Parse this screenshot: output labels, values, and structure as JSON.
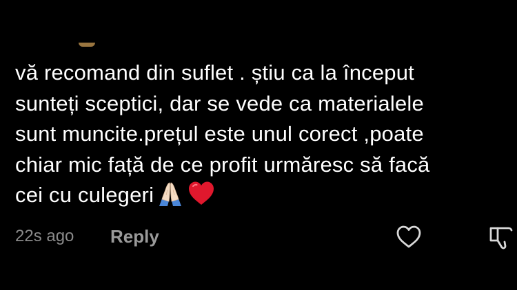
{
  "comment": {
    "lines": [
      "vă recomand din suflet . știu ca la început",
      "sunteți sceptici, dar se vede ca materialele",
      "sunt muncite.prețul este unul corect ,poate",
      "chiar mic față de ce profit urmăresc să facă",
      "cei cu culegeri"
    ],
    "emojis": [
      "folded-hands",
      "red-heart"
    ]
  },
  "actions": {
    "timestamp": "22s ago",
    "reply_label": "Reply"
  },
  "icons": {
    "like": "heart-outline-icon",
    "dislike": "thumbs-down-icon"
  },
  "colors": {
    "background": "#000000",
    "text": "#ffffff",
    "muted": "#8a8a8a",
    "heart": "#e0182d"
  }
}
